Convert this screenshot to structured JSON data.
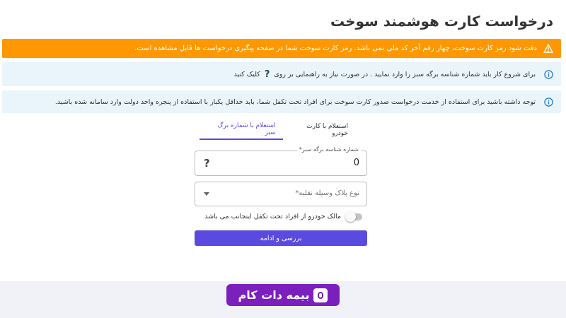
{
  "page": {
    "title": "درخواست کارت هوشمند سوخت"
  },
  "alerts": {
    "warning_text": "دقت شود رمز کارت سوخت، چهار رقم آخر کد ملی نمی باشد. رمز کارت سوخت شما در صفحه پیگیری درخواست ها قابل مشاهده است.",
    "info1_text_before": "برای شروع کار باید شماره شناسه برگه سبز را وارد نمایید . در صورت نیاز به راهنمایی بر روی",
    "info1_help_symbol": "?",
    "info1_text_after": "کلیک کنید",
    "info2_text": "توجه داشته باشید برای استفاده از خدمت درخواست صدور کارت سوخت برای افراد تحت تکفل شما، باید حداقل یکبار با استفاده از پنجره واحد دولت وارد سامانه شده باشید."
  },
  "tabs": [
    {
      "label": "استعلام با کارت خودرو",
      "active": false
    },
    {
      "label": "استعلام با شماره برگ سبز",
      "active": true
    }
  ],
  "form": {
    "green_sheet_label": "شماره شناسه برگه سبز*",
    "green_sheet_value": "0",
    "green_sheet_help": "?",
    "plate_type_placeholder": "نوع پلاک وسیله نقلیه*",
    "dependent_owner_label": "مالک خودرو از افراد تحت تکفل اینجانب می باشد",
    "dependent_owner_checked": false,
    "submit_label": "بررسی و ادامه"
  },
  "brand": {
    "logo_text": "بیمه دات کام",
    "logo_color": "#7b1fbd"
  },
  "colors": {
    "warning": "#ff9800",
    "info_bg": "#eaf4fb",
    "accent": "#5b4ae0"
  }
}
